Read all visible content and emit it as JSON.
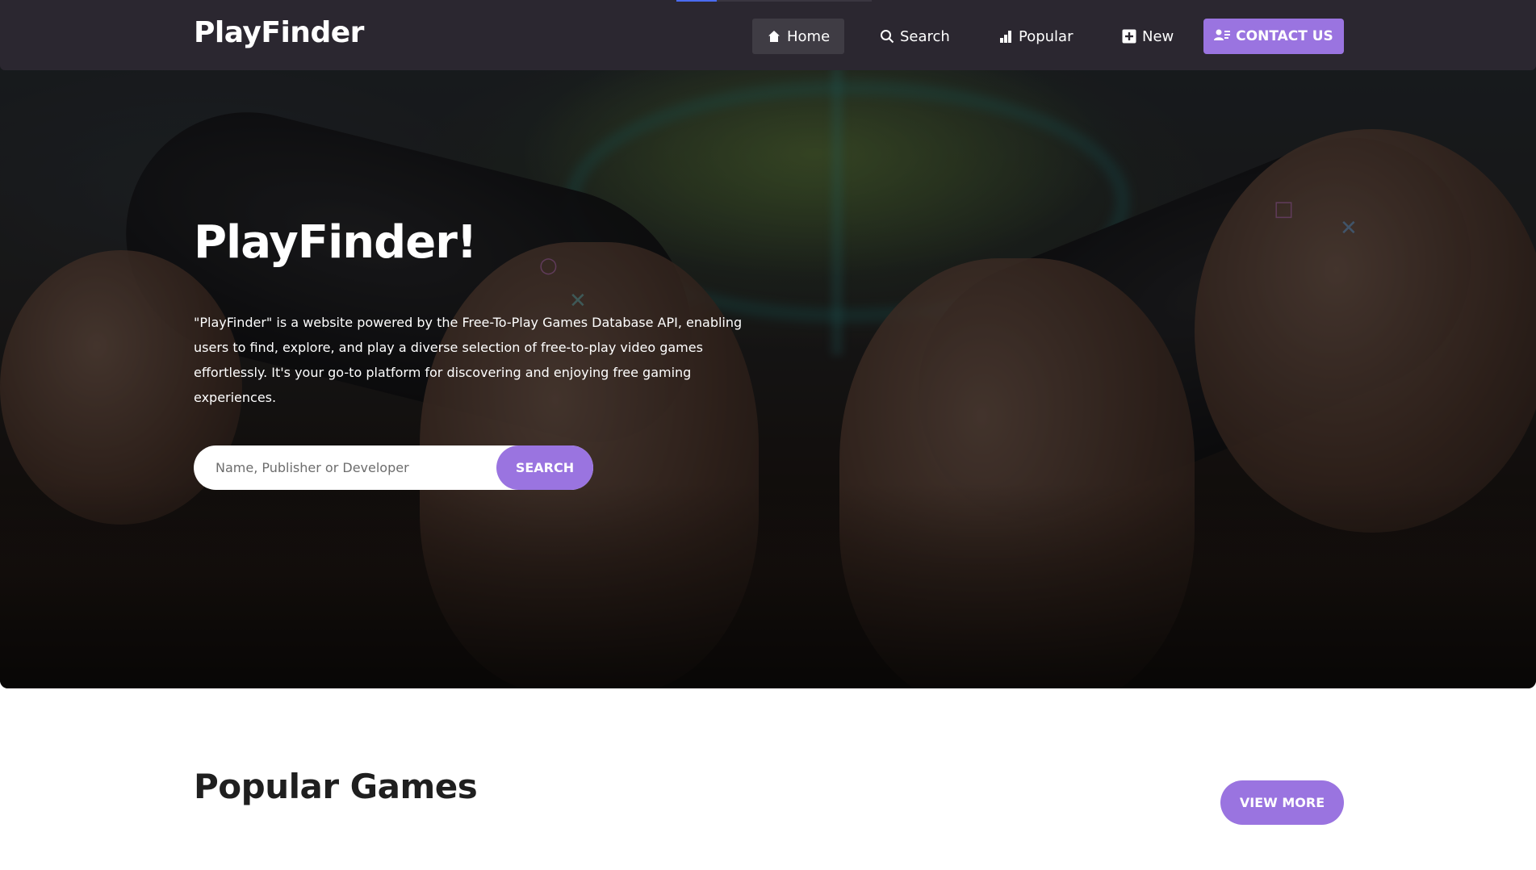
{
  "nav": {
    "brand": "PlayFinder",
    "items": [
      {
        "label": "Home",
        "icon": "home-icon",
        "active": true
      },
      {
        "label": "Search",
        "icon": "search-icon",
        "active": false
      },
      {
        "label": "Popular",
        "icon": "bar-chart-icon",
        "active": false
      },
      {
        "label": "New",
        "icon": "plus-square-icon",
        "active": false
      }
    ],
    "contact_label": "CONTACT US",
    "contact_icon": "user-card-icon"
  },
  "hero": {
    "title": "PlayFinder!",
    "description": "\"PlayFinder\" is a website powered by the Free-To-Play Games Database API, enabling users to find, explore, and play a diverse selection of free-to-play video games effortlessly. It's your go-to platform for discovering and enjoying free gaming experiences.",
    "search": {
      "placeholder": "Name, Publisher or Developer",
      "value": "",
      "button_label": "SEARCH"
    },
    "background_image": "hands holding game controllers in front of a TV"
  },
  "popular": {
    "title": "Popular Games",
    "view_more_label": "VIEW MORE"
  },
  "colors": {
    "accent": "#9a74e0",
    "navbar": "#2b2730",
    "nav_active": "#3f3c44"
  }
}
